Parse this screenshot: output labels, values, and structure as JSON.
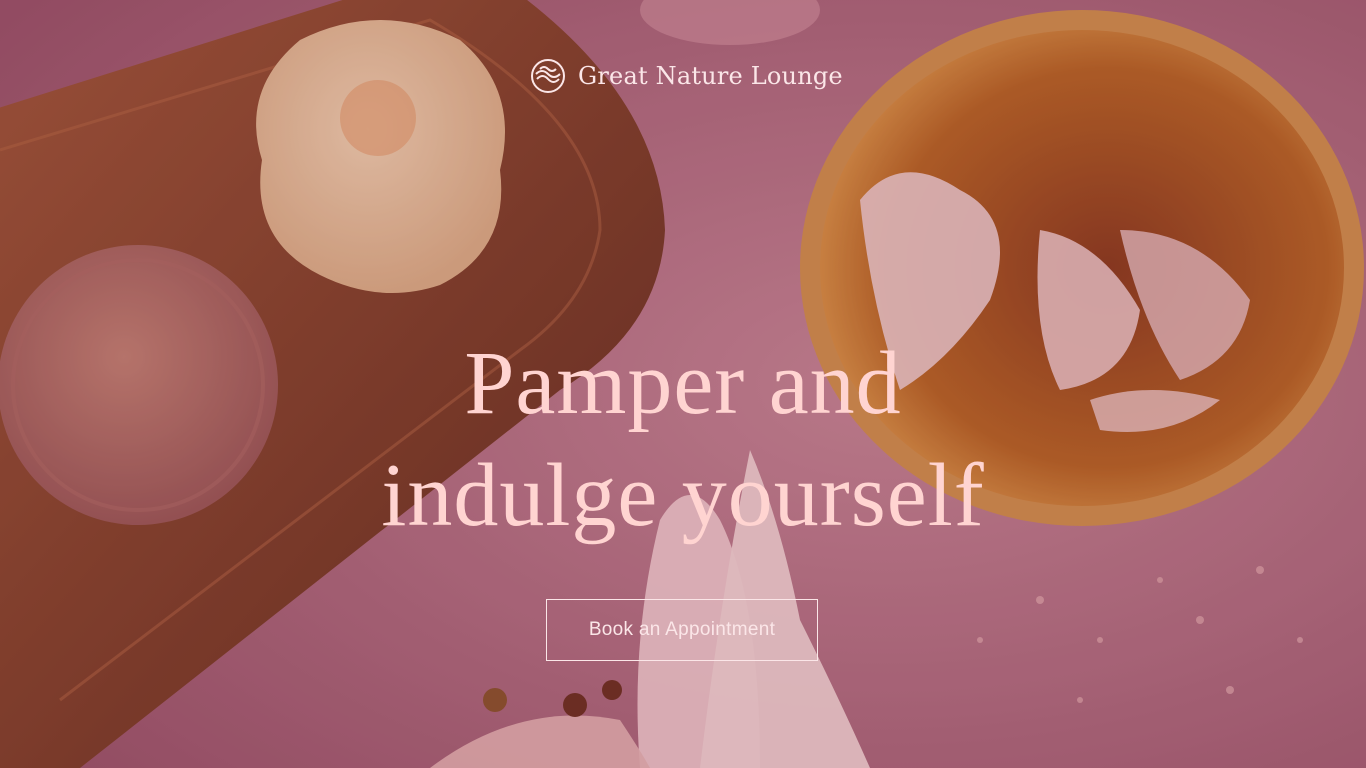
{
  "brand": {
    "name": "Great Nature Lounge",
    "logo_icon": "ripple-logo-icon"
  },
  "hero": {
    "headline_line1": "Pamper and",
    "headline_line2": "indulge yourself",
    "cta_label": "Book an Appointment"
  },
  "colors": {
    "background": "#b57283",
    "headline": "#ffd4d1",
    "text_light": "#fbe6e8",
    "tray": "#8a4a2c",
    "bowl": "#c27a2e"
  }
}
